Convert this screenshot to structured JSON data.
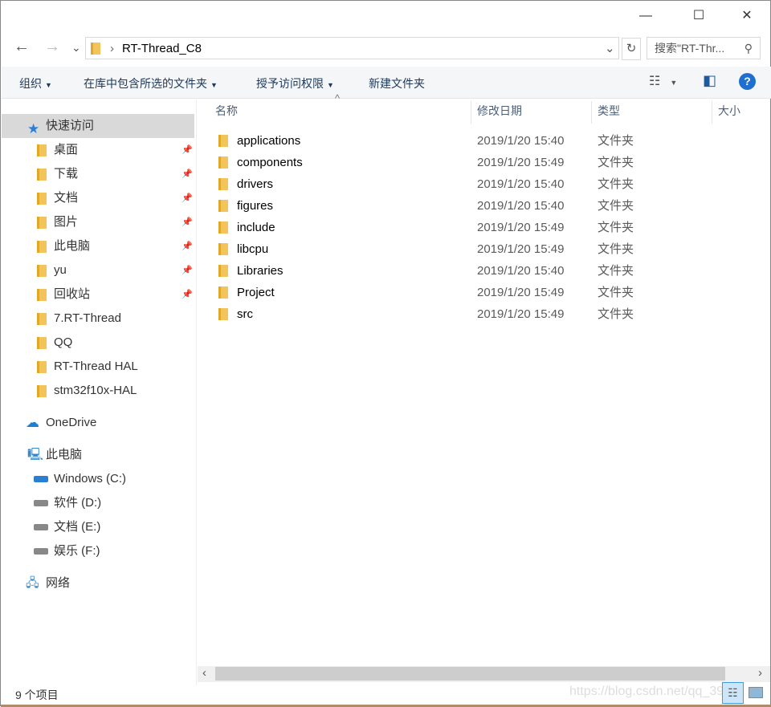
{
  "window": {
    "minimize": "—",
    "maximize": "☐",
    "close": "✕"
  },
  "nav": {
    "back": "←",
    "forward": "→",
    "recent": "⌄",
    "path_sep": "›",
    "path": "RT-Thread_C8",
    "dropdown": "⌄",
    "refresh": "↻",
    "search_placeholder": "搜索\"RT-Thr...",
    "search_icon": "⚲"
  },
  "toolbar": {
    "organize": "组织",
    "include_library": "在库中包含所选的文件夹",
    "share": "授予访问权限",
    "new_folder": "新建文件夹",
    "view_icon": "☷",
    "pane_icon": "◧",
    "help": "?"
  },
  "sidebar": {
    "quick_access": "快速访问",
    "pinned": [
      {
        "label": "桌面",
        "pinned": true
      },
      {
        "label": "下载",
        "pinned": true
      },
      {
        "label": "文档",
        "pinned": true
      },
      {
        "label": "图片",
        "pinned": true
      },
      {
        "label": "此电脑",
        "pinned": true
      },
      {
        "label": "yu",
        "pinned": true
      },
      {
        "label": "回收站",
        "pinned": true
      },
      {
        "label": "7.RT-Thread"
      },
      {
        "label": "QQ"
      },
      {
        "label": "RT-Thread HAL"
      },
      {
        "label": "stm32f10x-HAL"
      }
    ],
    "onedrive": "OneDrive",
    "this_pc": "此电脑",
    "drives": [
      {
        "label": "Windows (C:)"
      },
      {
        "label": "软件 (D:)"
      },
      {
        "label": "文档 (E:)"
      },
      {
        "label": "娱乐 (F:)"
      }
    ],
    "network": "网络"
  },
  "columns": {
    "name": "名称",
    "modified": "修改日期",
    "type": "类型",
    "size": "大小",
    "sort": "^"
  },
  "files": [
    {
      "name": "applications",
      "modified": "2019/1/20 15:40",
      "type": "文件夹"
    },
    {
      "name": "components",
      "modified": "2019/1/20 15:49",
      "type": "文件夹"
    },
    {
      "name": "drivers",
      "modified": "2019/1/20 15:40",
      "type": "文件夹"
    },
    {
      "name": "figures",
      "modified": "2019/1/20 15:40",
      "type": "文件夹"
    },
    {
      "name": "include",
      "modified": "2019/1/20 15:49",
      "type": "文件夹"
    },
    {
      "name": "libcpu",
      "modified": "2019/1/20 15:49",
      "type": "文件夹"
    },
    {
      "name": "Libraries",
      "modified": "2019/1/20 15:40",
      "type": "文件夹"
    },
    {
      "name": "Project",
      "modified": "2019/1/20 15:49",
      "type": "文件夹"
    },
    {
      "name": "src",
      "modified": "2019/1/20 15:49",
      "type": "文件夹"
    }
  ],
  "status": {
    "count": "9 个项目",
    "watermark": "https://blog.csdn.net/qq_39"
  },
  "scroll": {
    "left": "‹",
    "right": "›"
  }
}
